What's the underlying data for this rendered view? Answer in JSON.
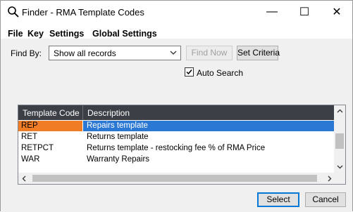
{
  "window": {
    "title": "Finder - RMA Template Codes",
    "icon": "search-icon",
    "controls": {
      "minimize": "—",
      "maximize": "☐",
      "close": "✕"
    }
  },
  "menu": [
    "File",
    "Key",
    "Settings",
    "Global Settings"
  ],
  "find": {
    "label": "Find By:",
    "selected": "Show all records",
    "find_now": "Find Now",
    "set_criteria": "Set Criteria",
    "auto_search_label": "Auto Search",
    "auto_search_checked": true
  },
  "grid": {
    "columns": [
      "Template Code",
      "Description"
    ],
    "rows": [
      {
        "code": "REP",
        "description": "Repairs template",
        "selected": true
      },
      {
        "code": "RET",
        "description": "Returns template",
        "selected": false
      },
      {
        "code": "RETPCT",
        "description": "Returns template - restocking fee % of RMA Price",
        "selected": false
      },
      {
        "code": "WAR",
        "description": "Warranty Repairs",
        "selected": false
      }
    ]
  },
  "footer": {
    "select": "Select",
    "cancel": "Cancel"
  },
  "colors": {
    "header_bg": "#3c3f46",
    "selected_code_bg": "#f07c25",
    "selected_row_bg": "#2b78d4",
    "accent": "#0078d7"
  }
}
